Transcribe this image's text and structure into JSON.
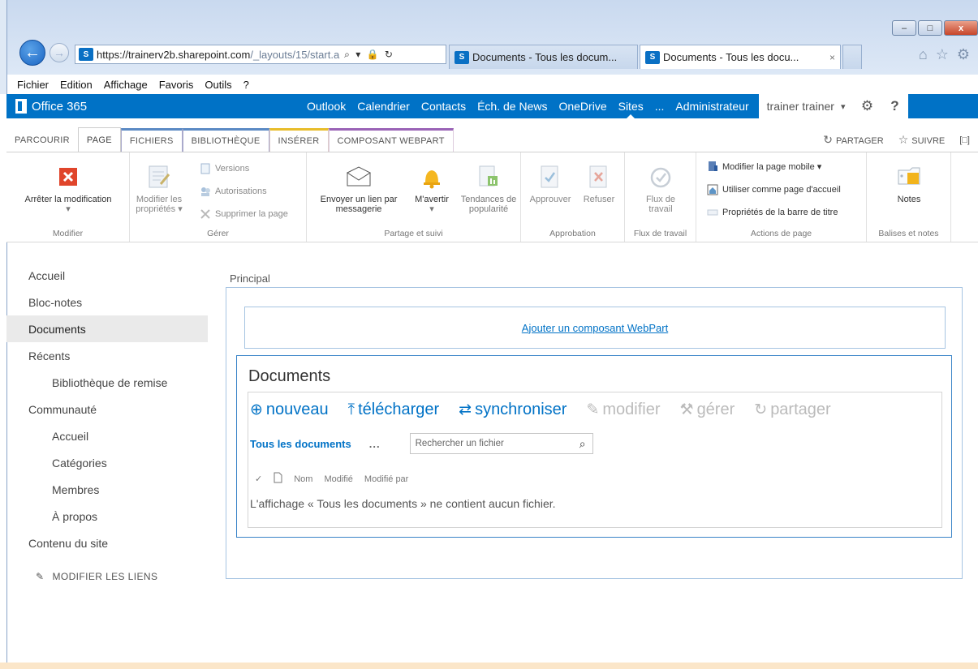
{
  "browser": {
    "url_host": "https://trainerv2b.sharepoint.com",
    "url_path": "/_layouts/15/start.a",
    "url_controls": "⌕ ▾ 🔒 ↻",
    "tabs": [
      {
        "title": "Documents - Tous les docum..."
      },
      {
        "title": "Documents - Tous les docu...",
        "close": "×"
      }
    ],
    "window_buttons": {
      "minimize": "–",
      "maximize": "□",
      "close": "x"
    },
    "tool_icons": [
      "home-icon",
      "star-icon",
      "gear-icon"
    ],
    "menu": [
      "Fichier",
      "Edition",
      "Affichage",
      "Favoris",
      "Outils",
      "?"
    ]
  },
  "suite": {
    "brand": "Office 365",
    "links": [
      "Outlook",
      "Calendrier",
      "Contacts",
      "Éch. de News",
      "OneDrive",
      "Sites",
      "..."
    ],
    "active_link": "Sites",
    "admin": "Administrateur",
    "user": "trainer trainer",
    "caret": "▾",
    "settings_icon": "⚙",
    "help_icon": "?",
    "color": "#0072c6"
  },
  "ribbon_tabs": {
    "tabs": [
      "PARCOURIR",
      "PAGE",
      "FICHIERS",
      "BIBLIOTHÈQUE",
      "INSÉRER",
      "COMPOSANT WEBPART"
    ],
    "selected": "PAGE",
    "share": "PARTAGER",
    "follow": "SUIVRE",
    "focus_icon": "[□]"
  },
  "ribbon": {
    "modifier": {
      "label": "Modifier",
      "stop_edit": "Arrêter la modification",
      "stop_caret": "▾"
    },
    "gerer": {
      "label": "Gérer",
      "edit_props_1": "Modifier les",
      "edit_props_2": "propriétés ▾",
      "versions": "Versions",
      "permissions": "Autorisations",
      "delete_page": "Supprimer la page"
    },
    "partage": {
      "label": "Partage et suivi",
      "send_link_1": "Envoyer un lien par",
      "send_link_2": "messagerie",
      "alert_1": "M'avertir",
      "alert_2": "▾",
      "trends_1": "Tendances de",
      "trends_2": "popularité"
    },
    "approbation": {
      "label": "Approbation",
      "approve": "Approuver",
      "reject": "Refuser"
    },
    "flux": {
      "label": "Flux de travail",
      "workflow_1": "Flux de",
      "workflow_2": "travail"
    },
    "actions": {
      "label": "Actions de page",
      "mobile": "Modifier la page mobile ▾",
      "homepage": "Utiliser comme page d'accueil",
      "titlebar": "Propriétés de la barre de titre"
    },
    "notes": {
      "label": "Balises et notes",
      "notes": "Notes"
    }
  },
  "leftnav": {
    "items": [
      {
        "label": "Accueil"
      },
      {
        "label": "Bloc-notes"
      },
      {
        "label": "Documents"
      },
      {
        "label": "Récents"
      },
      {
        "label": "Bibliothèque de remise"
      },
      {
        "label": "Communauté"
      },
      {
        "label": "Accueil"
      },
      {
        "label": "Catégories"
      },
      {
        "label": "Membres"
      },
      {
        "label": "À propos"
      },
      {
        "label": "Contenu du site"
      }
    ],
    "selected": "Documents",
    "edit_links": "MODIFIER LES LIENS"
  },
  "main": {
    "zone_label": "Principal",
    "add_webpart": "Ajouter un composant WebPart",
    "webpart_title": "Documents",
    "hero": {
      "new": "nouveau",
      "upload": "télécharger",
      "sync": "synchroniser",
      "edit": "modifier",
      "manage": "gérer",
      "share": "partager"
    },
    "view": "Tous les documents",
    "more": "...",
    "search_placeholder": "Rechercher un fichier",
    "columns": {
      "check": "✓",
      "name": "Nom",
      "modified": "Modifié",
      "modified_by": "Modifié par"
    },
    "empty_message": "L'affichage « Tous les documents » ne contient aucun fichier."
  }
}
